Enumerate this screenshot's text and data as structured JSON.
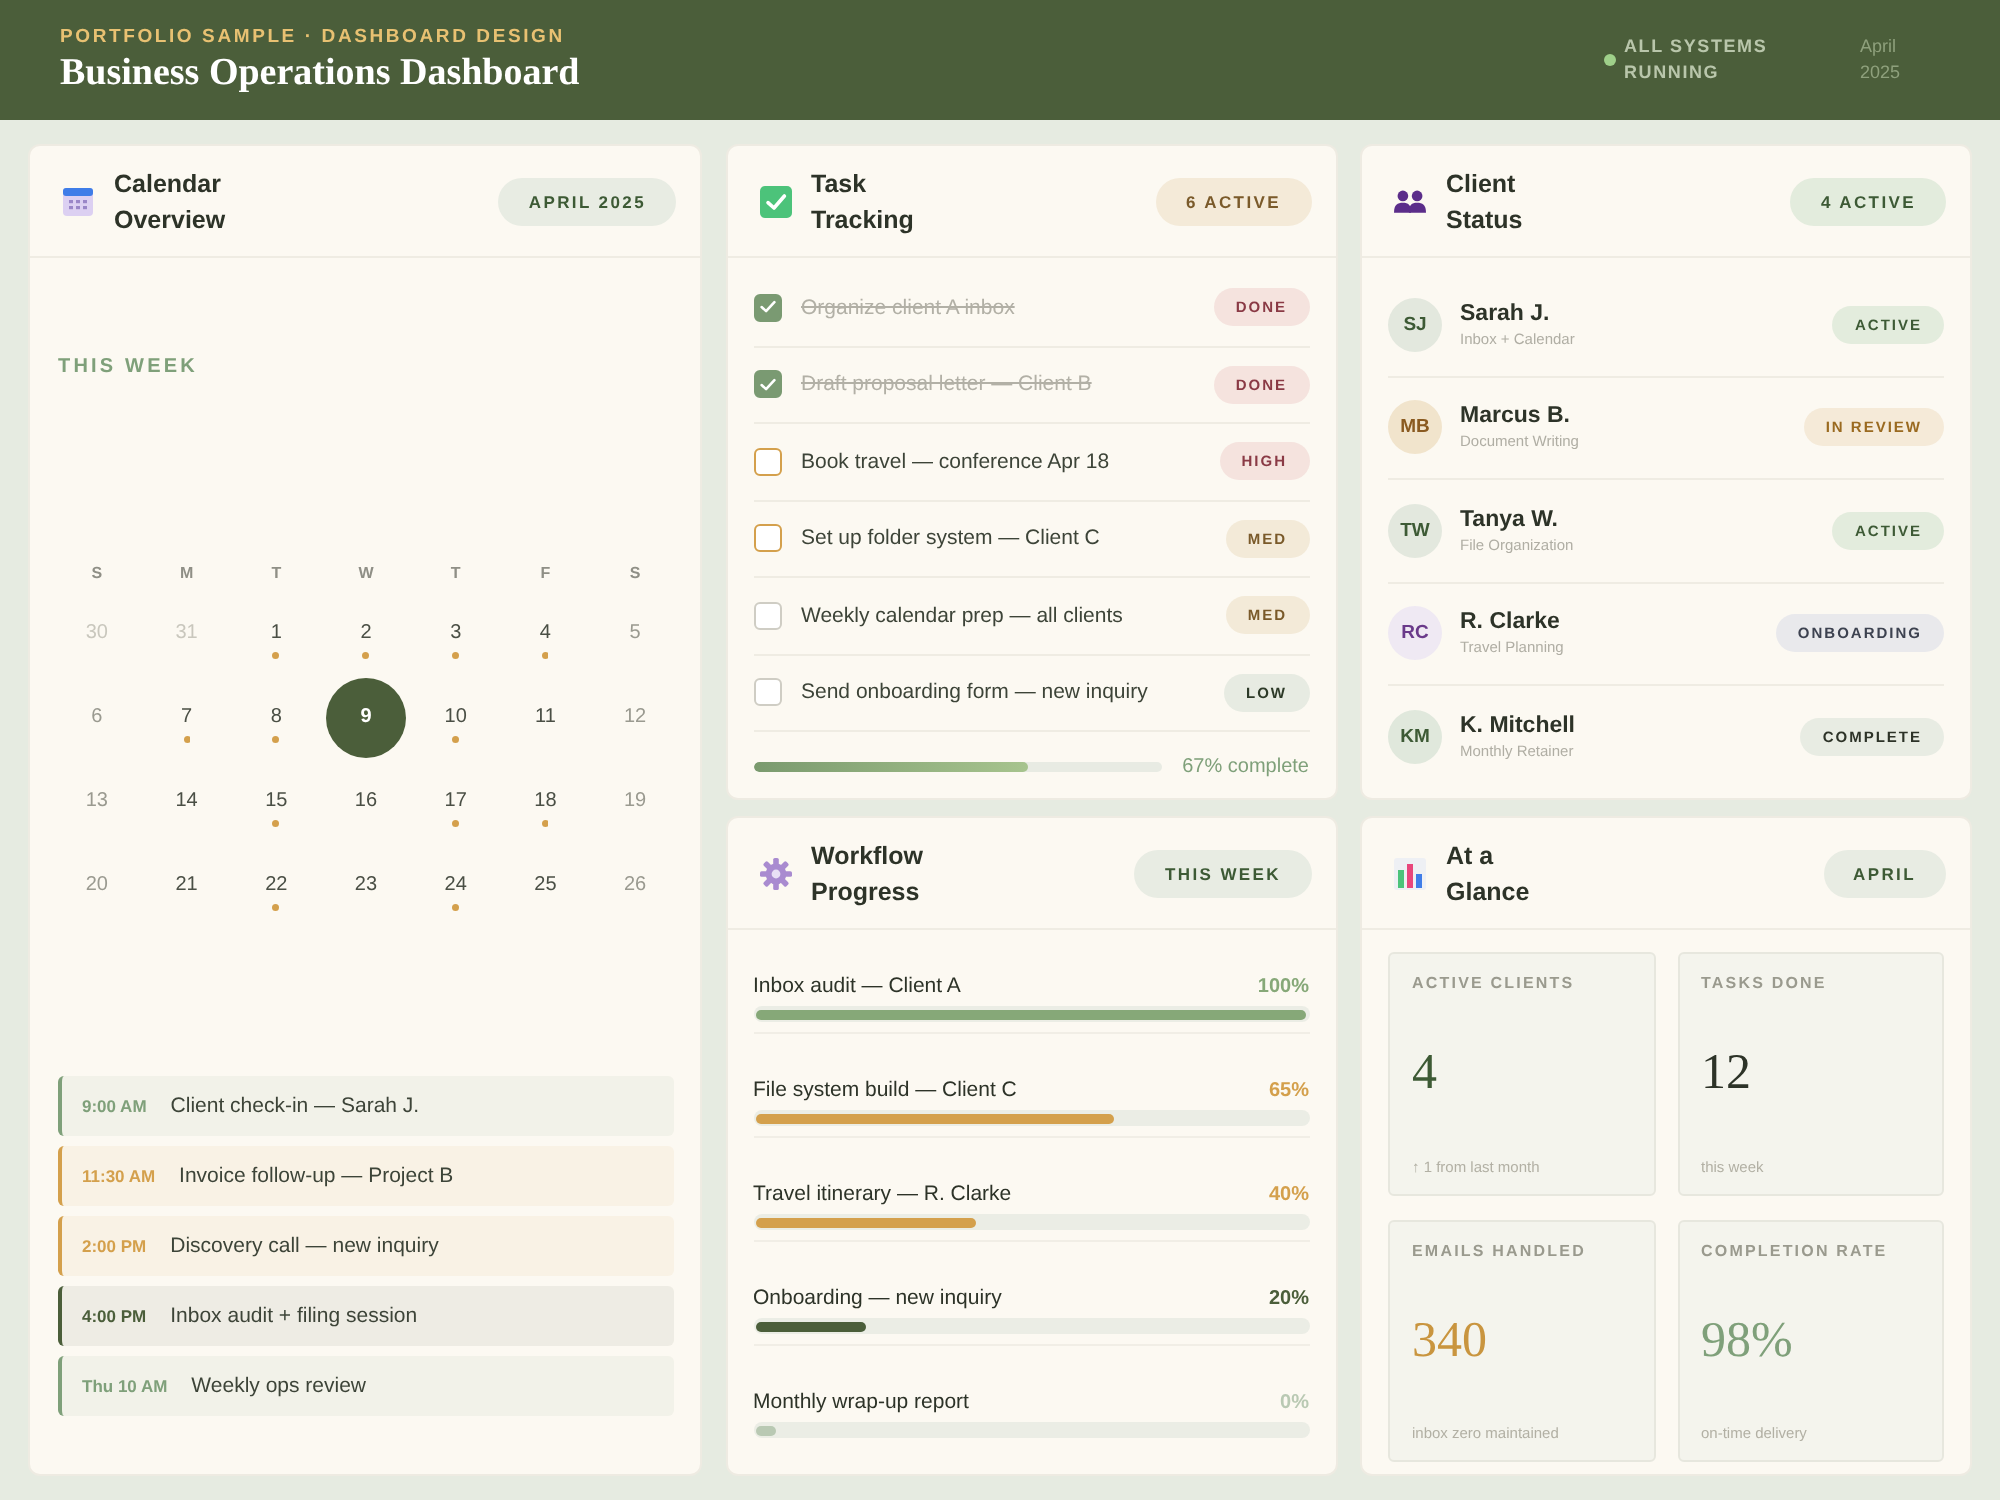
{
  "header": {
    "eyebrow": "PORTFOLIO SAMPLE · DASHBOARD DESIGN",
    "title": "Business Operations Dashboard",
    "status": "ALL SYSTEMS RUNNING",
    "date": "April 2025"
  },
  "calendar": {
    "title": "Calendar Overview",
    "badge": "APRIL 2025",
    "section_label": "THIS WEEK",
    "weekdays": [
      "S",
      "M",
      "T",
      "W",
      "T",
      "F",
      "S"
    ],
    "weeks": [
      [
        {
          "day": "30",
          "muted": true,
          "selected": false,
          "event": false
        },
        {
          "day": "31",
          "muted": true,
          "selected": false,
          "event": false
        },
        {
          "day": "1",
          "muted": false,
          "selected": false,
          "event": true
        },
        {
          "day": "2",
          "muted": false,
          "selected": false,
          "event": true
        },
        {
          "day": "3",
          "muted": false,
          "selected": false,
          "event": true
        },
        {
          "day": "4",
          "muted": false,
          "selected": false,
          "event": true
        },
        {
          "day": "5",
          "muted": false,
          "selected": false,
          "event": false
        }
      ],
      [
        {
          "day": "6",
          "muted": false,
          "selected": false,
          "event": false
        },
        {
          "day": "7",
          "muted": false,
          "selected": false,
          "event": true
        },
        {
          "day": "8",
          "muted": false,
          "selected": false,
          "event": true
        },
        {
          "day": "9",
          "muted": false,
          "selected": true,
          "event": false
        },
        {
          "day": "10",
          "muted": false,
          "selected": false,
          "event": true
        },
        {
          "day": "11",
          "muted": false,
          "selected": false,
          "event": false
        },
        {
          "day": "12",
          "muted": false,
          "selected": false,
          "event": false
        }
      ],
      [
        {
          "day": "13",
          "muted": false,
          "selected": false,
          "event": false
        },
        {
          "day": "14",
          "muted": false,
          "selected": false,
          "event": false
        },
        {
          "day": "15",
          "muted": false,
          "selected": false,
          "event": true
        },
        {
          "day": "16",
          "muted": false,
          "selected": false,
          "event": false
        },
        {
          "day": "17",
          "muted": false,
          "selected": false,
          "event": true
        },
        {
          "day": "18",
          "muted": false,
          "selected": false,
          "event": true
        },
        {
          "day": "19",
          "muted": false,
          "selected": false,
          "event": false
        }
      ],
      [
        {
          "day": "20",
          "muted": false,
          "selected": false,
          "event": false
        },
        {
          "day": "21",
          "muted": false,
          "selected": false,
          "event": false
        },
        {
          "day": "22",
          "muted": false,
          "selected": false,
          "event": true
        },
        {
          "day": "23",
          "muted": false,
          "selected": false,
          "event": false
        },
        {
          "day": "24",
          "muted": false,
          "selected": false,
          "event": true
        },
        {
          "day": "25",
          "muted": false,
          "selected": false,
          "event": false
        },
        {
          "day": "26",
          "muted": false,
          "selected": false,
          "event": false
        }
      ]
    ],
    "events": [
      {
        "time": "9:00 AM",
        "title": "Client check-in — Sarah J.",
        "color": "#7fa07a"
      },
      {
        "time": "11:30 AM",
        "title": "Invoice follow-up — Project B",
        "color": "#d4a04c"
      },
      {
        "time": "2:00 PM",
        "title": "Discovery call — new inquiry",
        "color": "#d4a04c"
      },
      {
        "time": "4:00 PM",
        "title": "Inbox audit + filing session",
        "color": "#4b5e3a"
      },
      {
        "time": "Thu 10 AM",
        "title": "Weekly ops review",
        "color": "#7fa07a"
      }
    ]
  },
  "tasks": {
    "title": "Task Tracking",
    "badge": "6 ACTIVE",
    "items": [
      {
        "label": "Organize client A inbox",
        "checked": true,
        "color": "#7a9a72",
        "tag": "DONE",
        "kind": "done"
      },
      {
        "label": "Draft proposal letter — Client B",
        "checked": true,
        "color": "#7a9a72",
        "tag": "DONE",
        "kind": "done"
      },
      {
        "label": "Book travel — conference Apr 18",
        "checked": false,
        "color": "#d4a04c",
        "tag": "HIGH",
        "kind": "high"
      },
      {
        "label": "Set up folder system — Client C",
        "checked": false,
        "color": "#d4a04c",
        "tag": "MED",
        "kind": "med"
      },
      {
        "label": "Weekly calendar prep — all clients",
        "checked": false,
        "color": "#cfcdc4",
        "tag": "MED",
        "kind": "med"
      },
      {
        "label": "Send onboarding form — new inquiry",
        "checked": false,
        "color": "#cfcdc4",
        "tag": "LOW",
        "kind": "low"
      }
    ],
    "progress": {
      "level": 0.67,
      "reading": "67% complete"
    }
  },
  "clients": {
    "title": "Client Status",
    "badge": "4 ACTIVE",
    "items": [
      {
        "initials": "SJ",
        "name": "Sarah J.",
        "service": "Inbox + Calendar",
        "status": "ACTIVE",
        "kind": "active"
      },
      {
        "initials": "MB",
        "name": "Marcus B.",
        "service": "Document Writing",
        "status": "IN REVIEW",
        "kind": "review"
      },
      {
        "initials": "TW",
        "name": "Tanya W.",
        "service": "File Organization",
        "status": "ACTIVE",
        "kind": "active"
      },
      {
        "initials": "RC",
        "name": "R. Clarke",
        "service": "Travel Planning",
        "status": "ONBOARDING",
        "kind": "onboarding"
      },
      {
        "initials": "KM",
        "name": "K. Mitchell",
        "service": "Monthly Retainer",
        "status": "COMPLETE",
        "kind": "complete"
      }
    ]
  },
  "workflow": {
    "title": "Workflow Progress",
    "badge": "THIS WEEK",
    "items": [
      {
        "label": "Inbox audit — Client A",
        "reading": "100%",
        "level": 1,
        "color": "#86a878"
      },
      {
        "label": "File system build — Client C",
        "reading": "65%",
        "level": 0.65,
        "color": "#d4a04c"
      },
      {
        "label": "Travel itinerary — R. Clarke",
        "reading": "40%",
        "level": 0.4,
        "color": "#d4a04c"
      },
      {
        "label": "Onboarding — new inquiry",
        "reading": "20%",
        "level": 0.2,
        "color": "#4b5e3a"
      },
      {
        "label": "Monthly wrap-up report",
        "reading": "0%",
        "level": 0,
        "color": "#b9c9b3"
      }
    ]
  },
  "glance": {
    "title": "At a Glance",
    "badge": "APRIL",
    "stats": [
      {
        "label": "ACTIVE CLIENTS",
        "value": "4",
        "note": "↑ 1 from last month",
        "color": "#3d5a35"
      },
      {
        "label": "TASKS DONE",
        "value": "12",
        "note": "this week",
        "color": "#2d3328"
      },
      {
        "label": "EMAILS HANDLED",
        "value": "340",
        "note": "inbox zero maintained",
        "color": "#c9953f"
      },
      {
        "label": "COMPLETION RATE",
        "value": "98%",
        "note": "on-time delivery",
        "color": "#7fa07a"
      }
    ]
  }
}
